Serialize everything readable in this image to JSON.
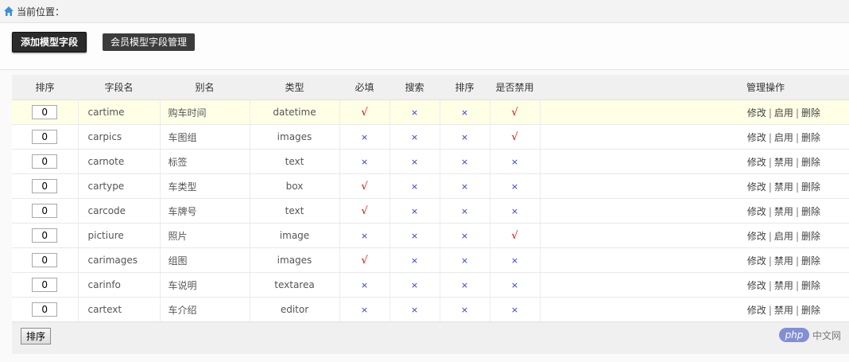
{
  "breadcrumb": {
    "label": "当前位置：",
    "icon": "home-icon"
  },
  "tabs": [
    {
      "label": "添加模型字段",
      "active": true
    },
    {
      "label": "会员模型字段管理",
      "active": false
    }
  ],
  "table": {
    "headers": [
      "排序",
      "字段名",
      "别名",
      "类型",
      "必填",
      "搜索",
      "排序",
      "是否禁用",
      "管理操作"
    ],
    "rows": [
      {
        "order": "0",
        "name": "cartime",
        "alias": "购车时间",
        "type": "datetime",
        "required": "√",
        "search": "×",
        "sort": "×",
        "disabled": "√",
        "ops": [
          "修改",
          "启用",
          "删除"
        ]
      },
      {
        "order": "0",
        "name": "carpics",
        "alias": "车图组",
        "type": "images",
        "required": "×",
        "search": "×",
        "sort": "×",
        "disabled": "√",
        "ops": [
          "修改",
          "启用",
          "删除"
        ]
      },
      {
        "order": "0",
        "name": "carnote",
        "alias": "标签",
        "type": "text",
        "required": "×",
        "search": "×",
        "sort": "×",
        "disabled": "×",
        "ops": [
          "修改",
          "禁用",
          "删除"
        ]
      },
      {
        "order": "0",
        "name": "cartype",
        "alias": "车类型",
        "type": "box",
        "required": "√",
        "search": "×",
        "sort": "×",
        "disabled": "×",
        "ops": [
          "修改",
          "禁用",
          "删除"
        ]
      },
      {
        "order": "0",
        "name": "carcode",
        "alias": "车牌号",
        "type": "text",
        "required": "√",
        "search": "×",
        "sort": "×",
        "disabled": "×",
        "ops": [
          "修改",
          "禁用",
          "删除"
        ]
      },
      {
        "order": "0",
        "name": "pictiure",
        "alias": "照片",
        "type": "image",
        "required": "×",
        "search": "×",
        "sort": "×",
        "disabled": "√",
        "ops": [
          "修改",
          "启用",
          "删除"
        ]
      },
      {
        "order": "0",
        "name": "carimages",
        "alias": "组图",
        "type": "images",
        "required": "√",
        "search": "×",
        "sort": "×",
        "disabled": "×",
        "ops": [
          "修改",
          "禁用",
          "删除"
        ]
      },
      {
        "order": "0",
        "name": "carinfo",
        "alias": "车说明",
        "type": "textarea",
        "required": "×",
        "search": "×",
        "sort": "×",
        "disabled": "×",
        "ops": [
          "修改",
          "禁用",
          "删除"
        ]
      },
      {
        "order": "0",
        "name": "cartext",
        "alias": "车介绍",
        "type": "editor",
        "required": "×",
        "search": "×",
        "sort": "×",
        "disabled": "×",
        "ops": [
          "修改",
          "禁用",
          "删除"
        ]
      }
    ]
  },
  "footer": {
    "sort_button": "排序"
  },
  "watermark": {
    "logo": "php",
    "text": "中文网"
  },
  "colors": {
    "yes": "#e00000",
    "no": "#2b3bd6",
    "highlight_row": "#ffffe6"
  }
}
